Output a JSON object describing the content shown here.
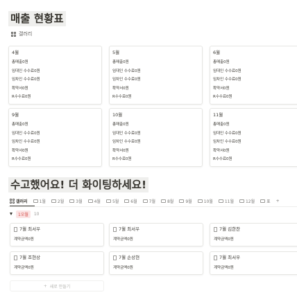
{
  "section1": {
    "title": "매출 현황표",
    "view_label": "갤러리",
    "cards": [
      {
        "month": "4월",
        "rows": [
          "총매출0원",
          "임대인 수수료0원",
          "임차인 수수료0원",
          "확약서0원",
          "R수수료0원"
        ]
      },
      {
        "month": "5월",
        "rows": [
          "총매출0원",
          "임대인 수수료0원",
          "임차인 수수료0원",
          "확약서0원",
          "R수수료0원"
        ]
      },
      {
        "month": "6월",
        "rows": [
          "총매출0원",
          "임대인 수수료0원",
          "임차인 수수료0원",
          "확약서0원",
          "R수수료0원"
        ]
      },
      {
        "month": "9월",
        "rows": [
          "총매출0원",
          "임대인 수수료0원",
          "임차인 수수료0원",
          "확약서0원",
          "R수수료0원"
        ]
      },
      {
        "month": "10월",
        "rows": [
          "총매출0원",
          "임대인 수수료0원",
          "임차인 수수료0원",
          "확약서0원",
          "R수수료0원"
        ]
      },
      {
        "month": "11월",
        "rows": [
          "총매출0원",
          "임대인 수수료0원",
          "임차인 수수료0원",
          "확약서0원",
          "R수수료0원"
        ]
      }
    ]
  },
  "section2": {
    "title": "수고했어요! 더 화이팅하세요!",
    "tabs": [
      "갤러리",
      "1월",
      "2월",
      "3월",
      "4월",
      "5월",
      "6월",
      "7월",
      "8월",
      "9월",
      "10월",
      "11월",
      "12월",
      "표"
    ],
    "add_tab": "+",
    "group": {
      "label": "1오월",
      "count": "10"
    },
    "cards": [
      {
        "name": "7월 최서우",
        "sub": "계약금액0원"
      },
      {
        "name": "7월 최서우",
        "sub": "계약금액0원"
      },
      {
        "name": "7월 김한찬",
        "sub": "계약금액0원"
      },
      {
        "name": "7월 조현상",
        "sub": "계약금액0원"
      },
      {
        "name": "7월 손상현",
        "sub": "계약금액0원"
      },
      {
        "name": "7월 최서우",
        "sub": "계약금액0원"
      }
    ],
    "new_button": "새로 만들기"
  }
}
